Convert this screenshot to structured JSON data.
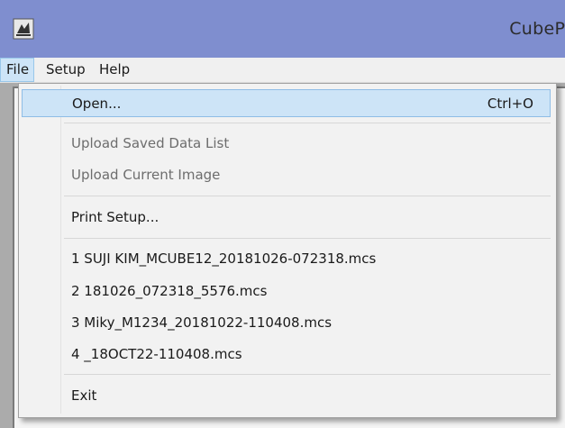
{
  "window": {
    "title": "CubePr",
    "icon": "app-icon"
  },
  "menubar": {
    "items": [
      {
        "label": "File"
      },
      {
        "label": "Setup"
      },
      {
        "label": "Help"
      }
    ]
  },
  "file_menu": {
    "open": {
      "label": "Open...",
      "shortcut": "Ctrl+O"
    },
    "upload_saved": {
      "label": "Upload Saved Data List"
    },
    "upload_current": {
      "label": "Upload Current Image"
    },
    "print_setup": {
      "label": "Print Setup..."
    },
    "recent": [
      {
        "label": "1 SUJI KIM_MCUBE12_20181026-072318.mcs"
      },
      {
        "label": "2 181026_072318_5576.mcs"
      },
      {
        "label": "3 Miky_M1234_20181022-110408.mcs"
      },
      {
        "label": "4 _18OCT22-110408.mcs"
      }
    ],
    "exit": {
      "label": "Exit"
    }
  },
  "colors": {
    "titlebar": "#7f8ecf",
    "highlight": "#cde4f7",
    "highlight_border": "#8fbde6",
    "disabled_text": "#6d6d6d"
  }
}
